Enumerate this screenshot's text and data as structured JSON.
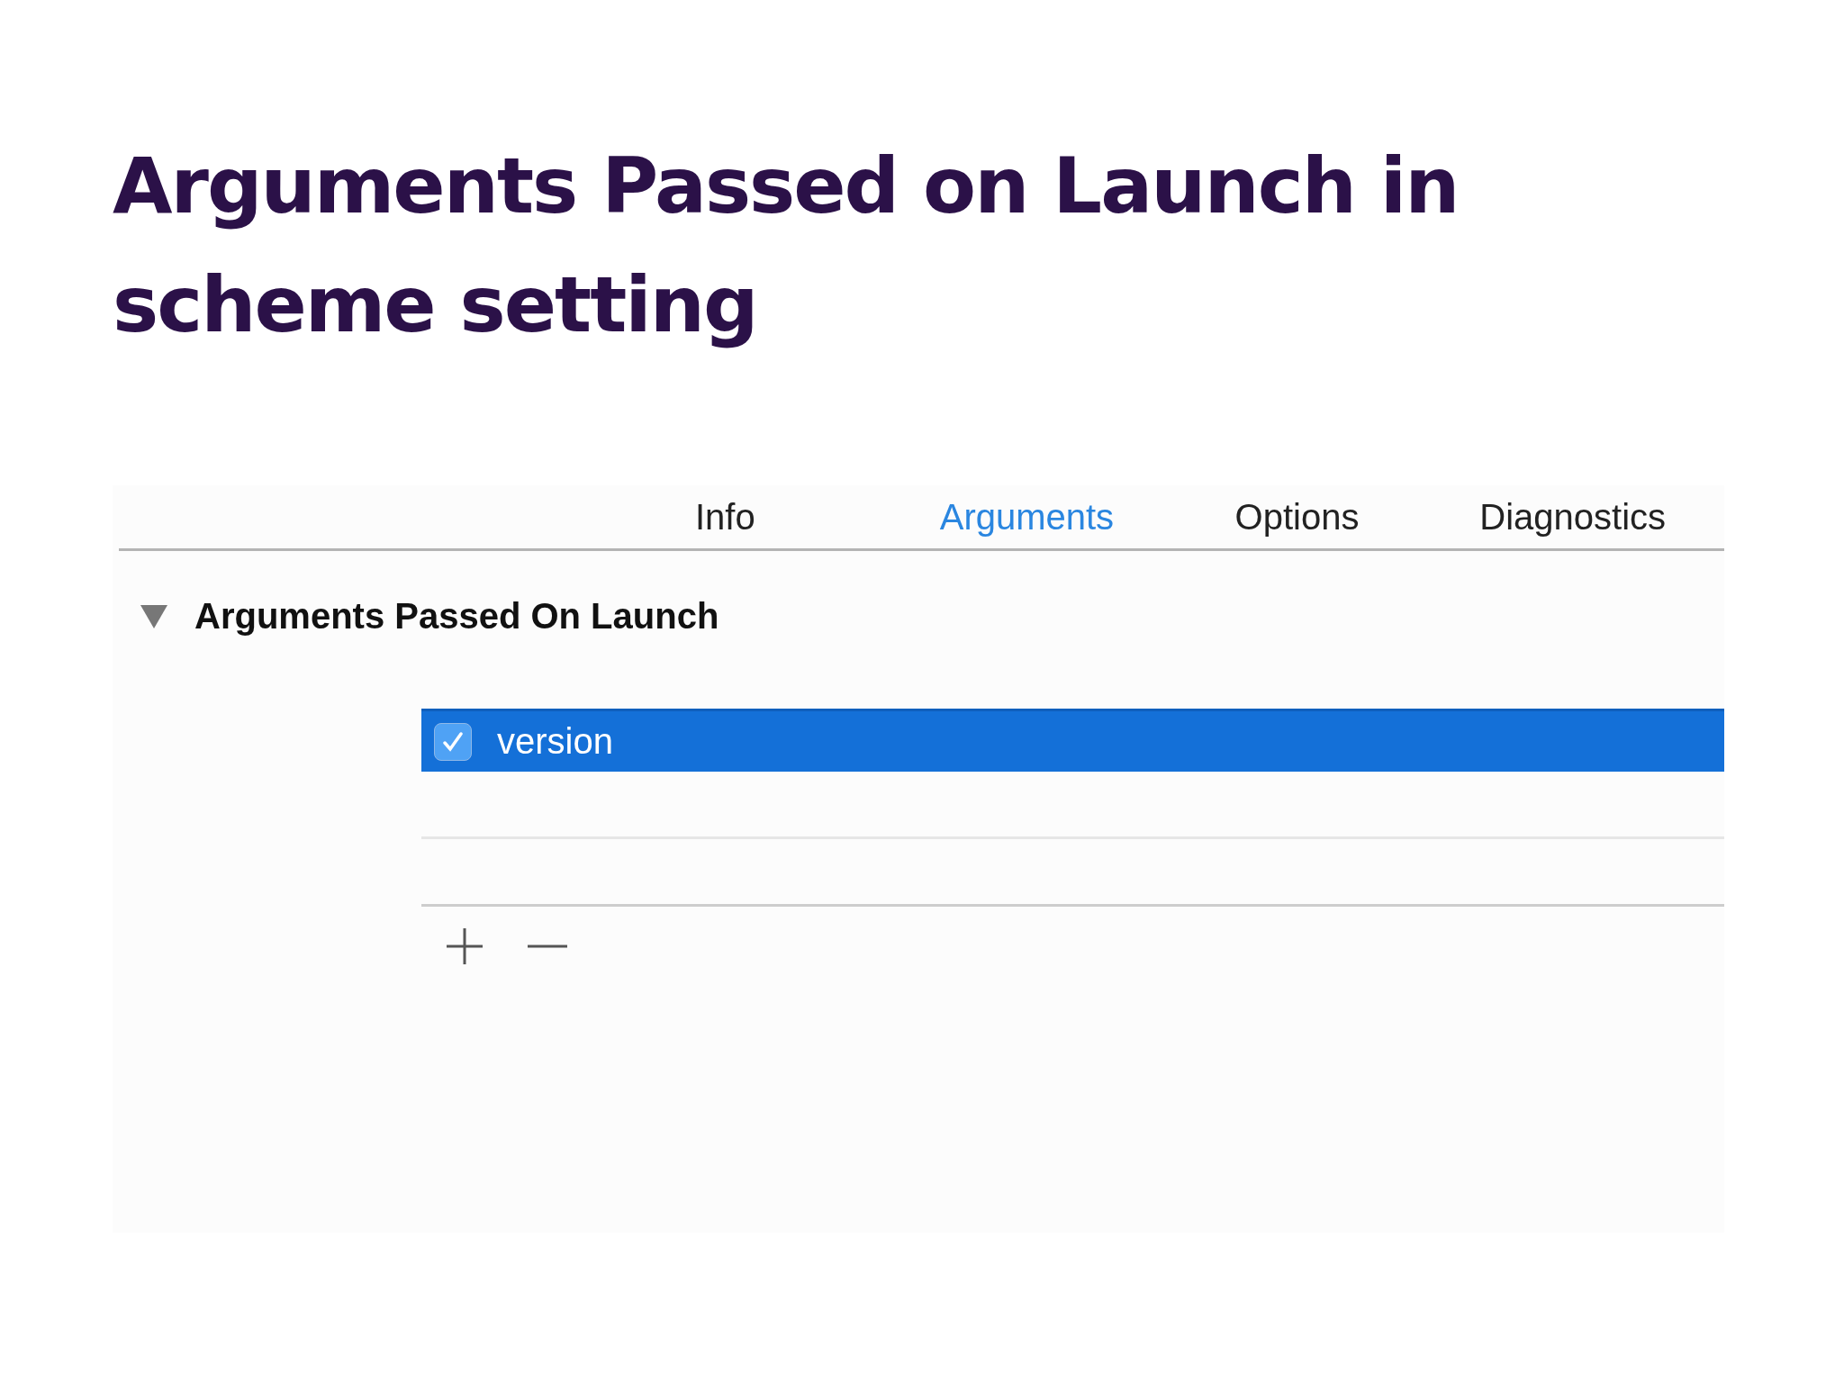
{
  "slide_title": "Arguments Passed on Launch in scheme setting",
  "tabs": [
    {
      "label": "Info",
      "selected": false
    },
    {
      "label": "Arguments",
      "selected": true
    },
    {
      "label": "Options",
      "selected": false
    },
    {
      "label": "Diagnostics",
      "selected": false
    }
  ],
  "section": {
    "title": "Arguments Passed On Launch",
    "expanded": true
  },
  "arguments": [
    {
      "text": "version",
      "checked": true,
      "selected": true
    }
  ]
}
